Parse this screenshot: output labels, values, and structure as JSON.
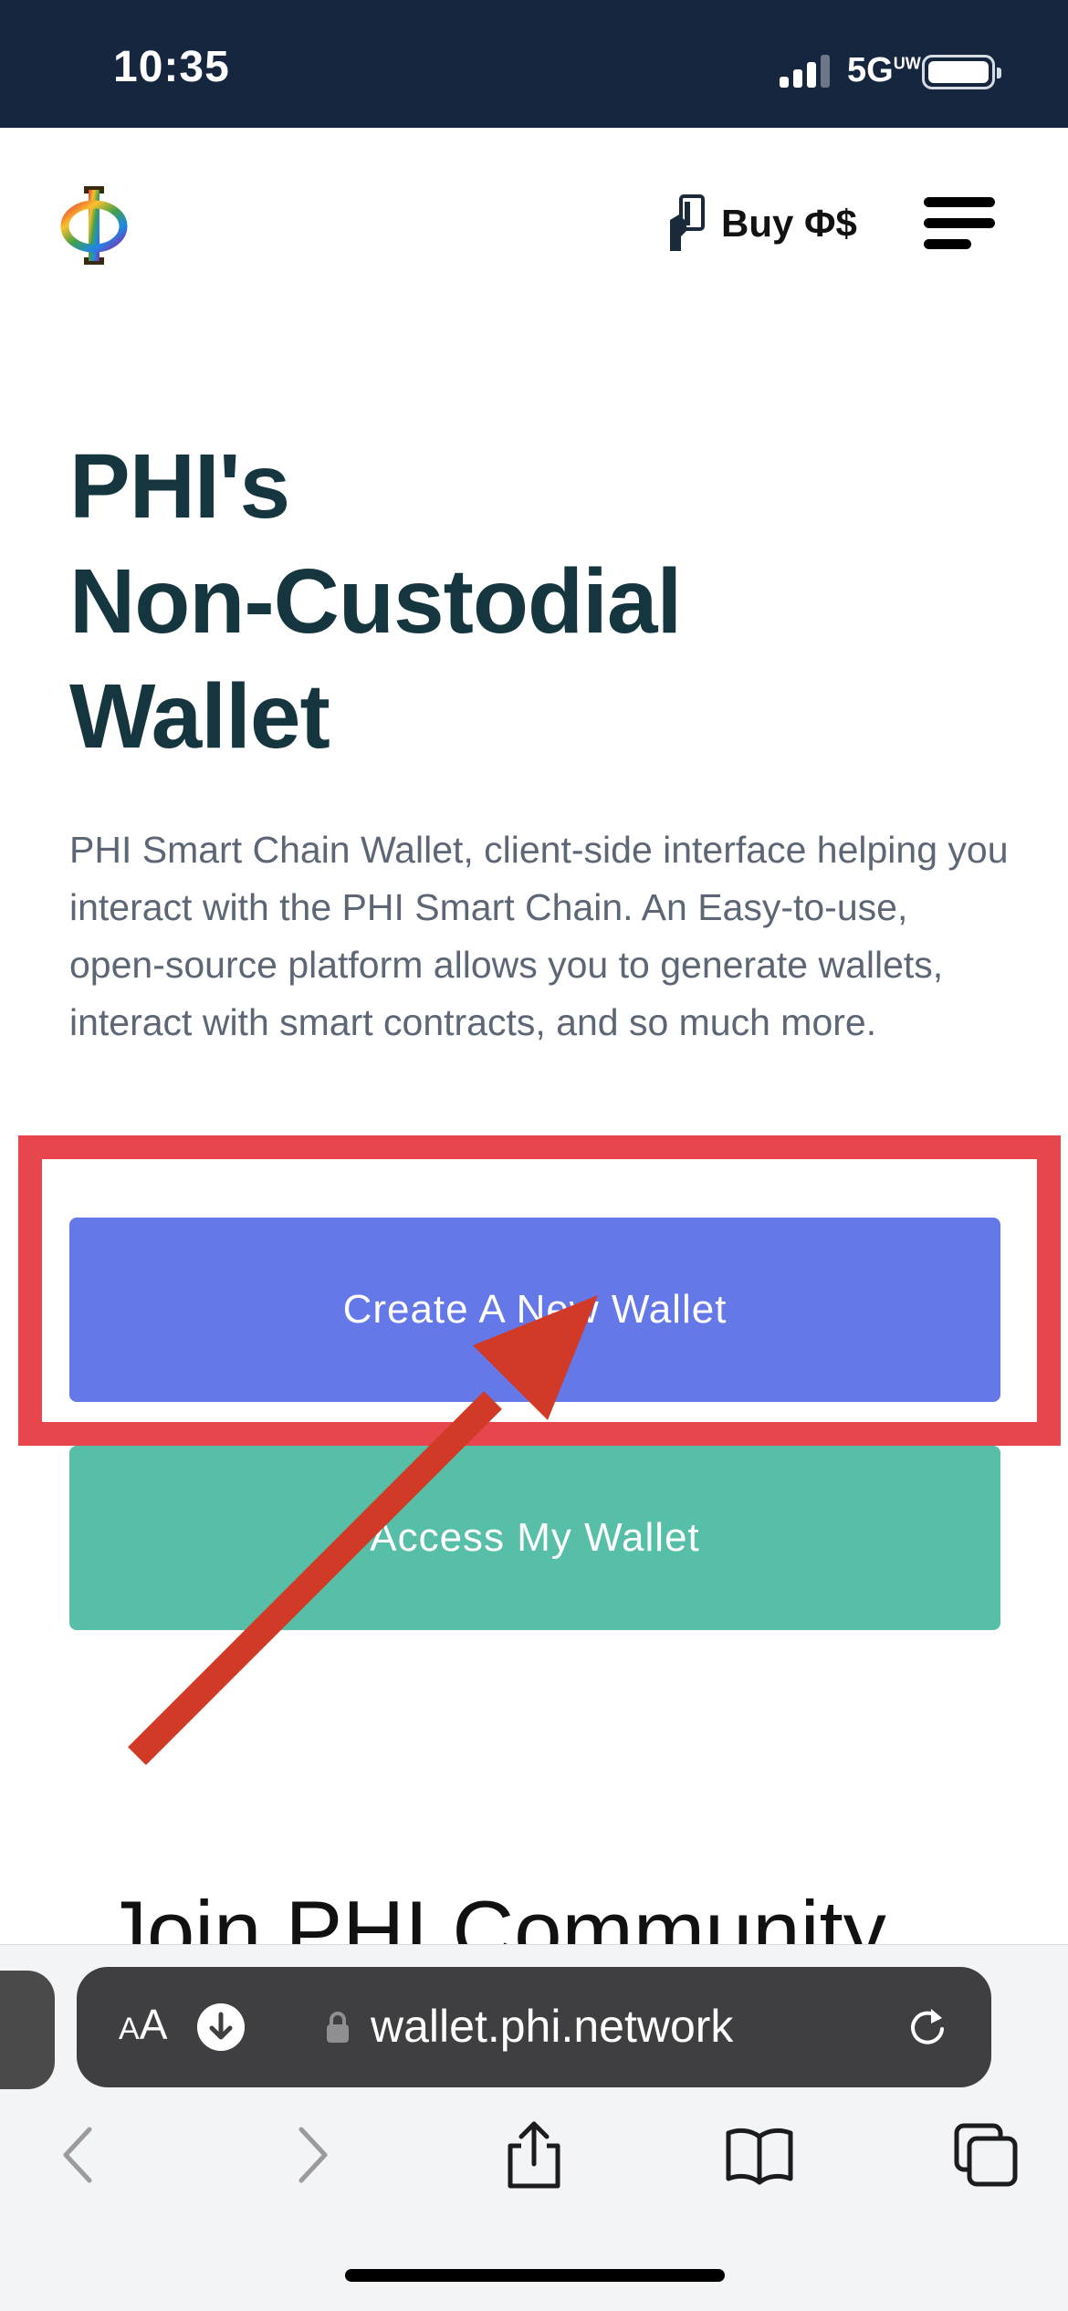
{
  "status_bar": {
    "time": "10:35",
    "network_label": "5G",
    "network_superscript": "UW",
    "signal_icon": "signal-bars-icon",
    "battery_icon": "battery-icon"
  },
  "header": {
    "logo_icon": "phi-logo-icon",
    "buy_label": "Buy Φ$",
    "buy_icon": "hand-card-icon",
    "menu_icon": "hamburger-menu-icon"
  },
  "hero": {
    "title_line1": "PHI's",
    "title_line2": "Non-Custodial",
    "title_line3": "Wallet",
    "description": "PHI Smart Chain Wallet, client-side interface helping you interact with the PHI Smart Chain. An Easy-to-use, open-source platform allows you to generate wallets, interact with smart contracts, and so much more.",
    "create_button": "Create A New Wallet",
    "access_button": "Access My Wallet"
  },
  "section": {
    "join_heading": "Join PHI Community"
  },
  "browser": {
    "text_size_label": "A",
    "text_size_label_large": "A",
    "url": "wallet.phi.network",
    "icons": [
      "download-icon",
      "lock-icon",
      "reload-icon",
      "back-icon",
      "forward-icon",
      "share-icon",
      "bookmarks-icon",
      "tabs-icon"
    ]
  },
  "colors": {
    "status_bar_bg": "#17263f",
    "title": "#15363f",
    "create_button": "#6478e8",
    "access_button": "#57bfa7",
    "annotation": "#e8464d",
    "arrow": "#d13a26"
  }
}
